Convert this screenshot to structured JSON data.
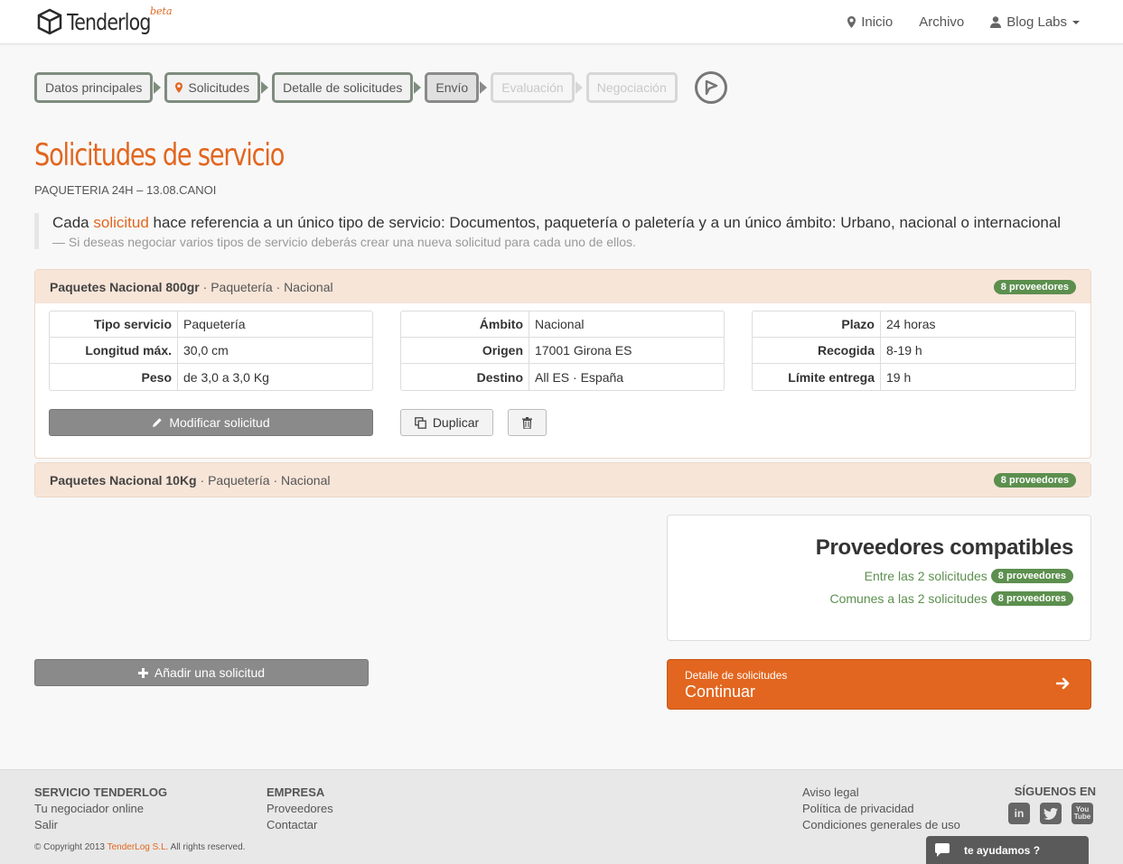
{
  "brand": {
    "name": "Tenderlog",
    "tag": "beta"
  },
  "nav": {
    "home": "Inicio",
    "archive": "Archivo",
    "user": "Blog Labs"
  },
  "steps": [
    "Datos principales",
    "Solicitudes",
    "Detalle de solicitudes",
    "Envío",
    "Evaluación",
    "Negociación"
  ],
  "page": {
    "title": "Solicitudes de servicio",
    "subtitle": "PAQUETERIA 24H – 13.08.CANOI",
    "quote_pre": "Cada ",
    "quote_link": "solicitud",
    "quote_post": " hace referencia a un único tipo de servicio: Documentos, paquetería o paletería y a un único ámbito: Urbano, nacional o internacional",
    "quote_small": "— Si deseas negociar varios tipos de servicio deberás crear una nueva solicitud para cada uno de ellos."
  },
  "request1": {
    "name": "Paquetes Nacional 800gr",
    "meta": " · Paquetería · Nacional",
    "badge": "8 proveedores",
    "t1": [
      [
        "Tipo servicio",
        "Paquetería"
      ],
      [
        "Longitud máx.",
        "30,0 cm"
      ],
      [
        "Peso",
        "de 3,0 a 3,0 Kg"
      ]
    ],
    "t2": [
      [
        "Ámbito",
        "Nacional"
      ],
      [
        "Origen",
        "17001 Girona ES"
      ],
      [
        "Destino",
        "All ES · España"
      ]
    ],
    "t3": [
      [
        "Plazo",
        "24 horas"
      ],
      [
        "Recogida",
        "8-19 h"
      ],
      [
        "Límite entrega",
        "19 h"
      ]
    ],
    "modify": "Modificar solicitud",
    "duplicate": "Duplicar"
  },
  "request2": {
    "name": "Paquetes Nacional 10Kg",
    "meta": " · Paquetería · Nacional",
    "badge": "8 proveedores"
  },
  "add_request": "Añadir una solicitud",
  "compat": {
    "title": "Proveedores compatibles",
    "row1": "Entre las 2 solicitudes",
    "row1_badge": "8 proveedores",
    "row2": "Comunes a las 2 solicitudes",
    "row2_badge": "8 proveedores"
  },
  "continue": {
    "small": "Detalle de solicitudes",
    "big": "Continuar"
  },
  "footer": {
    "col1_title": "SERVICIO TENDERLOG",
    "col1_a": "Tu negociador online",
    "col1_b": "Salir",
    "col2_title": "EMPRESA",
    "col2_a": "Proveedores",
    "col2_b": "Contactar",
    "legal": "Aviso legal",
    "privacy": "Política de privacidad",
    "terms": "Condiciones generales de uso",
    "follow": "SÍGUENOS EN",
    "copy_pre": "© Copyright 2013 ",
    "copy_company": "TenderLog S.L.",
    "copy_post": " All rights reserved.",
    "social": [
      "in",
      "t",
      "You Tube"
    ]
  },
  "chat": "te ayudamos ?",
  "colors": {
    "accent": "#e2661f",
    "badge_green": "#5c8f4e"
  }
}
